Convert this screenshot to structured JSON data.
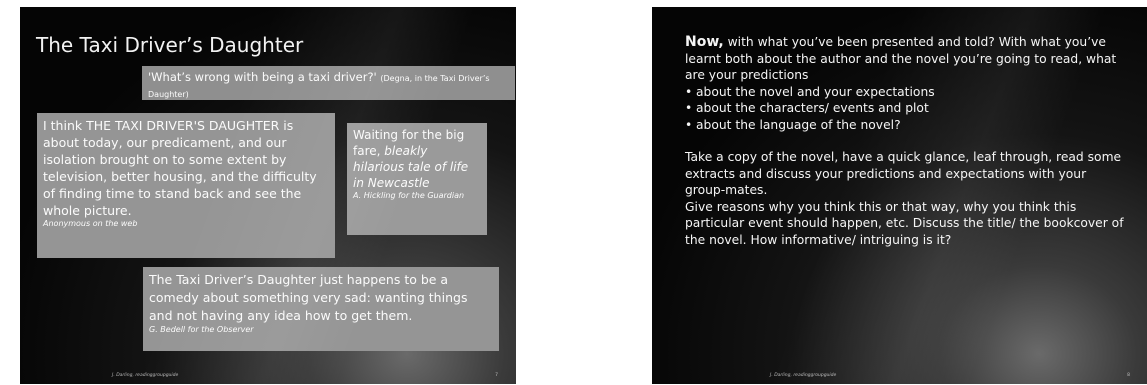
{
  "slide1": {
    "title": "The Taxi Driver’s Daughter",
    "quote": {
      "text": "'What’s wrong with being a taxi driver?'",
      "attribution": "(Degna, in the Taxi Driver’s Daughter)"
    },
    "review1": {
      "text": "I think THE TAXI DRIVER'S DAUGHTER is about today, our predicament, and our isolation brought on to some extent by television, better housing, and the difficulty of finding time to stand back and see the whole picture.",
      "credit": "Anonymous on the web"
    },
    "review2": {
      "text_plain": "Waiting for the big fare,",
      "text_italic": "bleakly hilarious tale of life in Newcastle",
      "credit": "A. Hickling for the Guardian"
    },
    "review3": {
      "text": "The Taxi Driver’s Daughter just happens to be a comedy about something very sad: wanting things and not having any idea how to get them.",
      "credit": "G. Bedell for the Observer"
    },
    "footer": "J. Darling, readinggroupguide",
    "page_number": "7"
  },
  "slide2": {
    "intro_bold": "Now,",
    "intro_rest": " with what you’ve been presented and told? With what you’ve learnt both about the author and the novel you’re going to read, what are your predictions",
    "bullets": [
      "about the novel and your expectations",
      "about the characters/ events and plot",
      "about the language of the novel?"
    ],
    "paragraph2": "Take a copy of the novel, have a quick glance, leaf through, read some extracts and discuss your predictions and expectations with your group-mates.",
    "paragraph3": "Give reasons why you think this or that way, why you think this particular event should happen, etc. Discuss the title/ the bookcover of the novel. How informative/ intriguing is it?",
    "footer": "J. Darling, readinggroupguide",
    "page_number": "8"
  }
}
